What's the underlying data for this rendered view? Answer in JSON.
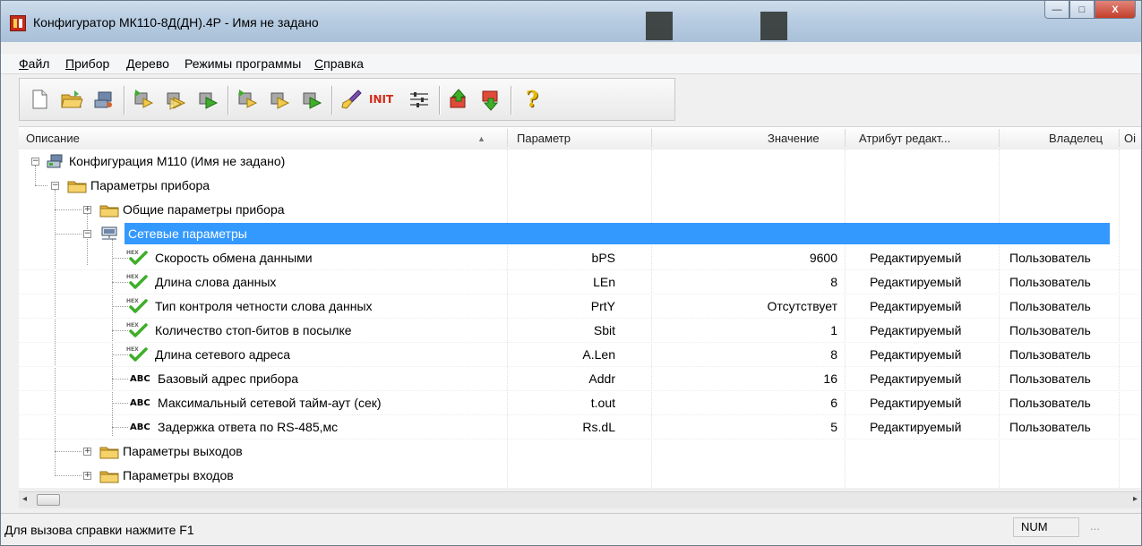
{
  "window": {
    "title": "Конфигуратор МК110-8Д(ДН).4Р - Имя не задано",
    "controls": {
      "minimize": "—",
      "maximize": "□",
      "close": "X"
    }
  },
  "menu": [
    "Файл",
    "Прибор",
    "Дерево",
    "Режимы программы",
    "Справка"
  ],
  "toolbar": {
    "buttons": [
      "new-file-icon",
      "open-folder-icon",
      "network-icon",
      "read-icon",
      "read-all-icon",
      "write-icon",
      "read-green-icon",
      "read-yellow-icon",
      "write-green-icon",
      "brush-icon",
      "init-icon",
      "equalizer-icon",
      "upload-icon",
      "download-icon",
      "help-icon"
    ],
    "init_label": "INIT",
    "help_label": "?"
  },
  "columns": {
    "description": "Описание",
    "sort_indicator": "▲",
    "parameter": "Параметр",
    "value": "Значение",
    "attribute": "Атрибут редакт...",
    "owner": "Владелец",
    "extra": "Оі"
  },
  "tree": {
    "root": {
      "label": "Конфигурация М110 (Имя не задано)",
      "expander": "−"
    },
    "device_params": {
      "label": "Параметры прибора",
      "expander": "−"
    },
    "general_params": {
      "label": "Общие параметры прибора",
      "expander": "+"
    },
    "network_params": {
      "label": "Сетевые параметры",
      "expander": "−"
    },
    "network_rows": [
      {
        "icon": "check",
        "desc": "Скорость обмена данными",
        "param": "bPS",
        "value": "9600",
        "attr": "Редактируемый",
        "owner": "Пользователь"
      },
      {
        "icon": "check",
        "desc": "Длина слова данных",
        "param": "LEn",
        "value": "8",
        "attr": "Редактируемый",
        "owner": "Пользователь"
      },
      {
        "icon": "check",
        "desc": "Тип контроля четности слова данных",
        "param": "PrtY",
        "value": "Отсутствует",
        "attr": "Редактируемый",
        "owner": "Пользователь"
      },
      {
        "icon": "check",
        "desc": "Количество стоп-битов в посылке",
        "param": "Sbit",
        "value": "1",
        "attr": "Редактируемый",
        "owner": "Пользователь"
      },
      {
        "icon": "check",
        "desc": "Длина сетевого адреса",
        "param": "A.Len",
        "value": "8",
        "attr": "Редактируемый",
        "owner": "Пользователь"
      },
      {
        "icon": "abc",
        "desc": "Базовый адрес прибора",
        "param": "Addr",
        "value": "16",
        "attr": "Редактируемый",
        "owner": "Пользователь"
      },
      {
        "icon": "abc",
        "desc": "Максимальный сетевой тайм-аут (сек)",
        "param": "t.out",
        "value": "6",
        "attr": "Редактируемый",
        "owner": "Пользователь"
      },
      {
        "icon": "abc",
        "desc": "Задержка ответа по RS-485,мс",
        "param": "Rs.dL",
        "value": "5",
        "attr": "Редактируемый",
        "owner": "Пользователь"
      }
    ],
    "output_params": {
      "label": "Параметры выходов",
      "expander": "+"
    },
    "input_params": {
      "label": "Параметры входов",
      "expander": "+"
    },
    "icon_labels": {
      "check_badge": "HEX",
      "abc": "ABC"
    }
  },
  "scrollbar": {
    "left_arrow": "◂",
    "right_arrow": "▸"
  },
  "status": {
    "hint": "Для вызова справки нажмите F1",
    "num": "NUM",
    "grip": "..."
  },
  "colors": {
    "selection": "#3399ff",
    "check_green": "#3fae2a",
    "folder_yellow": "#f2c94c"
  }
}
